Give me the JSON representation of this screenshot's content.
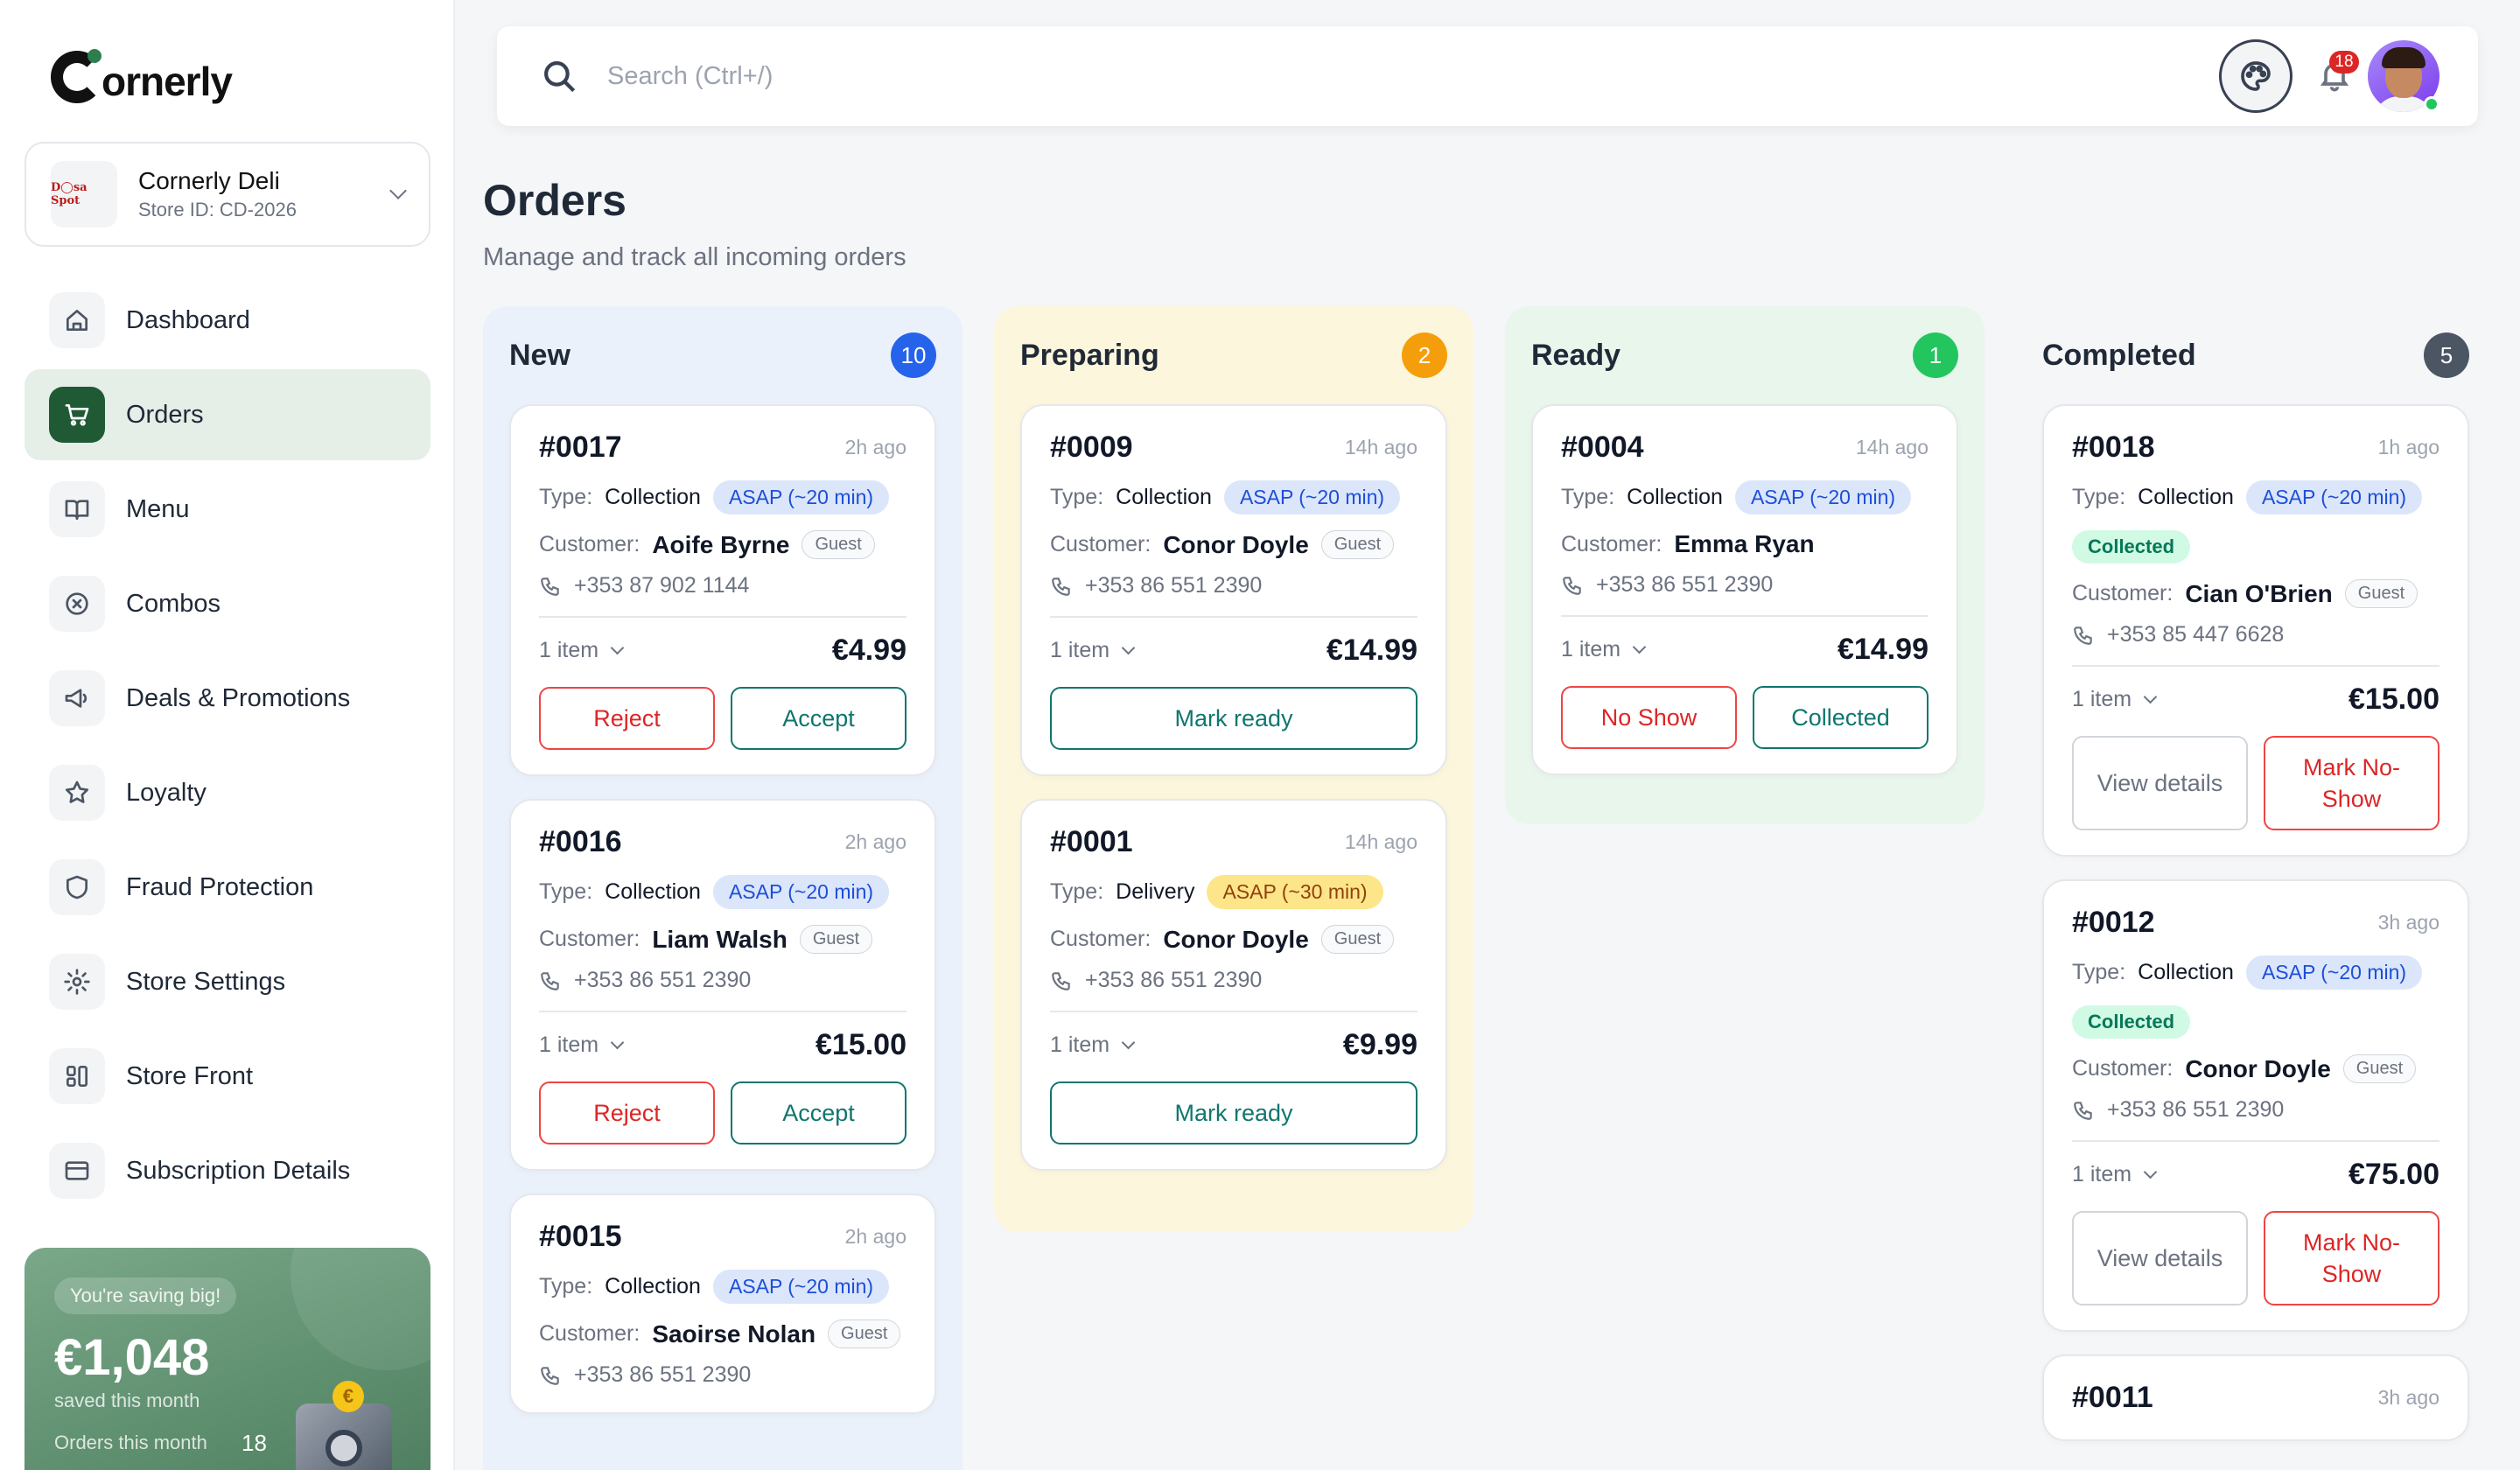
{
  "brand": {
    "name": "ornerly"
  },
  "store": {
    "logo_text": "D◯sa Spot",
    "name": "Cornerly Deli",
    "id": "Store ID: CD-2026"
  },
  "nav": [
    {
      "label": "Dashboard",
      "icon": "home-icon",
      "active": false
    },
    {
      "label": "Orders",
      "icon": "cart-icon",
      "active": true
    },
    {
      "label": "Menu",
      "icon": "book-icon",
      "active": false
    },
    {
      "label": "Combos",
      "icon": "badge-icon",
      "active": false
    },
    {
      "label": "Deals & Promotions",
      "icon": "megaphone-icon",
      "active": false
    },
    {
      "label": "Loyalty",
      "icon": "star-icon",
      "active": false
    },
    {
      "label": "Fraud Protection",
      "icon": "shield-icon",
      "active": false
    },
    {
      "label": "Store Settings",
      "icon": "gear-icon",
      "active": false
    },
    {
      "label": "Store Front",
      "icon": "layout-icon",
      "active": false
    },
    {
      "label": "Subscription Details",
      "icon": "card-icon",
      "active": false
    }
  ],
  "promo": {
    "badge": "You're saving big!",
    "amount": "€1,048",
    "sub": "saved this month",
    "orders_label": "Orders this month",
    "orders_value": "18",
    "coin": "€"
  },
  "search": {
    "placeholder": "Search (Ctrl+/)"
  },
  "notifications": {
    "count": "18"
  },
  "page": {
    "title": "Orders",
    "subtitle": "Manage and track all incoming orders"
  },
  "labels": {
    "type": "Type:",
    "customer": "Customer:"
  },
  "columns": [
    {
      "title": "New",
      "count": "10",
      "color": "#2563eb",
      "orders": [
        {
          "id": "#0017",
          "age": "2h ago",
          "type": "Collection",
          "eta": "ASAP (~20 min)",
          "eta_style": "blue",
          "status": "",
          "customer": "Aoife Byrne",
          "guest": "Guest",
          "phone": "+353 87 902 1144",
          "items": "1 item",
          "price": "€4.99",
          "actions": [
            {
              "label": "Reject",
              "style": "red"
            },
            {
              "label": "Accept",
              "style": "teal"
            }
          ]
        },
        {
          "id": "#0016",
          "age": "2h ago",
          "type": "Collection",
          "eta": "ASAP (~20 min)",
          "eta_style": "blue",
          "status": "",
          "customer": "Liam Walsh",
          "guest": "Guest",
          "phone": "+353 86 551 2390",
          "items": "1 item",
          "price": "€15.00",
          "actions": [
            {
              "label": "Reject",
              "style": "red"
            },
            {
              "label": "Accept",
              "style": "teal"
            }
          ]
        },
        {
          "id": "#0015",
          "age": "2h ago",
          "type": "Collection",
          "eta": "ASAP (~20 min)",
          "eta_style": "blue",
          "status": "",
          "customer": "Saoirse Nolan",
          "guest": "Guest",
          "phone": "+353 86 551 2390",
          "items": "",
          "price": "",
          "actions": []
        }
      ]
    },
    {
      "title": "Preparing",
      "count": "2",
      "color": "#f59e0b",
      "orders": [
        {
          "id": "#0009",
          "age": "14h ago",
          "type": "Collection",
          "eta": "ASAP (~20 min)",
          "eta_style": "blue",
          "status": "",
          "customer": "Conor Doyle",
          "guest": "Guest",
          "phone": "+353 86 551 2390",
          "items": "1 item",
          "price": "€14.99",
          "actions": [
            {
              "label": "Mark ready",
              "style": "teal"
            }
          ]
        },
        {
          "id": "#0001",
          "age": "14h ago",
          "type": "Delivery",
          "eta": "ASAP (~30 min)",
          "eta_style": "amber",
          "status": "",
          "customer": "Conor Doyle",
          "guest": "Guest",
          "phone": "+353 86 551 2390",
          "items": "1 item",
          "price": "€9.99",
          "actions": [
            {
              "label": "Mark ready",
              "style": "teal"
            }
          ]
        }
      ]
    },
    {
      "title": "Ready",
      "count": "1",
      "color": "#22c55e",
      "orders": [
        {
          "id": "#0004",
          "age": "14h ago",
          "type": "Collection",
          "eta": "ASAP (~20 min)",
          "eta_style": "blue",
          "status": "",
          "customer": "Emma Ryan",
          "guest": "",
          "phone": "+353 86 551 2390",
          "items": "1 item",
          "price": "€14.99",
          "actions": [
            {
              "label": "No Show",
              "style": "red"
            },
            {
              "label": "Collected",
              "style": "teal"
            }
          ]
        }
      ]
    },
    {
      "title": "Completed",
      "count": "5",
      "color": "#4b5563",
      "orders": [
        {
          "id": "#0018",
          "age": "1h ago",
          "type": "Collection",
          "eta": "ASAP (~20 min)",
          "eta_style": "blue",
          "status": "Collected",
          "customer": "Cian O'Brien",
          "guest": "Guest",
          "phone": "+353 85 447 6628",
          "items": "1 item",
          "price": "€15.00",
          "actions": [
            {
              "label": "View details",
              "style": "grey"
            },
            {
              "label": "Mark No-Show",
              "style": "red"
            }
          ]
        },
        {
          "id": "#0012",
          "age": "3h ago",
          "type": "Collection",
          "eta": "ASAP (~20 min)",
          "eta_style": "blue",
          "status": "Collected",
          "customer": "Conor Doyle",
          "guest": "Guest",
          "phone": "+353 86 551 2390",
          "items": "1 item",
          "price": "€75.00",
          "actions": [
            {
              "label": "View details",
              "style": "grey"
            },
            {
              "label": "Mark No-Show",
              "style": "red"
            }
          ]
        },
        {
          "id": "#0011",
          "age": "3h ago",
          "type": "",
          "eta": "",
          "eta_style": "blue",
          "status": "",
          "customer": "",
          "guest": "",
          "phone": "",
          "items": "",
          "price": "",
          "actions": []
        }
      ]
    }
  ]
}
